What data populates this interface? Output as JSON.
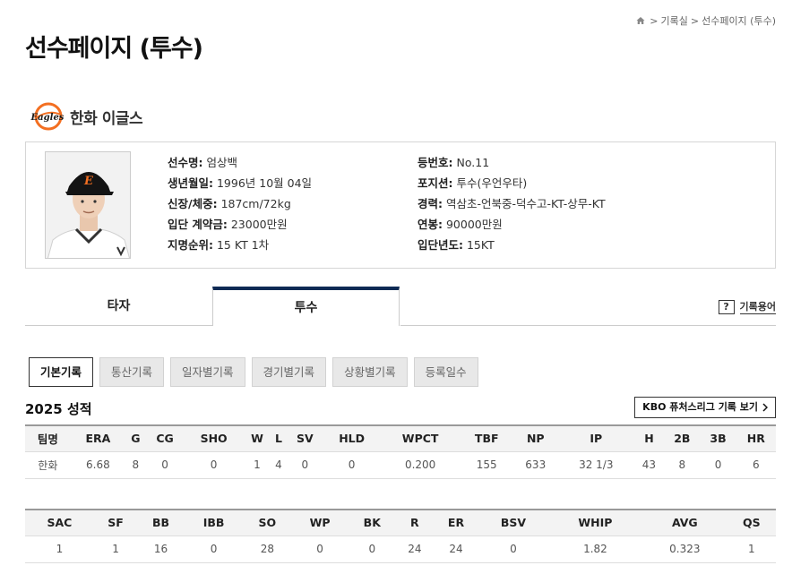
{
  "breadcrumb": {
    "items": [
      "기록실",
      "선수페이지 (투수)"
    ],
    "sep": ">"
  },
  "page_title": "선수페이지 (투수)",
  "team": {
    "name": "한화 이글스",
    "logo_text": "Eagles",
    "brand_color": "#f36f21"
  },
  "player": {
    "left": [
      {
        "label": "선수명:",
        "value": "엄상백"
      },
      {
        "label": "생년월일:",
        "value": "1996년 10월 04일"
      },
      {
        "label": "신장/체중:",
        "value": "187cm/72kg"
      },
      {
        "label": "입단 계약금:",
        "value": "23000만원"
      },
      {
        "label": "지명순위:",
        "value": "15 KT 1차"
      }
    ],
    "right": [
      {
        "label": "등번호:",
        "value": "No.11"
      },
      {
        "label": "포지션:",
        "value": "투수(우언우타)"
      },
      {
        "label": "경력:",
        "value": "역삼초-언북중-덕수고-KT-상무-KT"
      },
      {
        "label": "연봉:",
        "value": "90000만원"
      },
      {
        "label": "입단년도:",
        "value": "15KT"
      }
    ]
  },
  "tabs": {
    "batter": "타자",
    "pitcher": "투수",
    "active": "pitcher"
  },
  "glossary": {
    "icon": "?",
    "label": "기록용어"
  },
  "sub_tabs": [
    "기본기록",
    "통산기록",
    "일자별기록",
    "경기별기록",
    "상황별기록",
    "등록일수"
  ],
  "season_title": "2025 성적",
  "futures_button": "KBO 퓨처스리그 기록 보기",
  "table1": {
    "headers": [
      "팀명",
      "ERA",
      "G",
      "CG",
      "SHO",
      "W",
      "L",
      "SV",
      "HLD",
      "WPCT",
      "TBF",
      "NP",
      "IP",
      "H",
      "2B",
      "3B",
      "HR"
    ],
    "row": [
      "한화",
      "6.68",
      "8",
      "0",
      "0",
      "1",
      "4",
      "0",
      "0",
      "0.200",
      "155",
      "633",
      "32 1/3",
      "43",
      "8",
      "0",
      "6"
    ]
  },
  "table2": {
    "headers": [
      "SAC",
      "SF",
      "BB",
      "IBB",
      "SO",
      "WP",
      "BK",
      "R",
      "ER",
      "BSV",
      "WHIP",
      "AVG",
      "QS"
    ],
    "row": [
      "1",
      "1",
      "16",
      "0",
      "28",
      "0",
      "0",
      "24",
      "24",
      "0",
      "1.82",
      "0.323",
      "1"
    ]
  },
  "colors": {
    "tab_accent": "#0e2a54",
    "header_bg": "#f3f3f3"
  }
}
